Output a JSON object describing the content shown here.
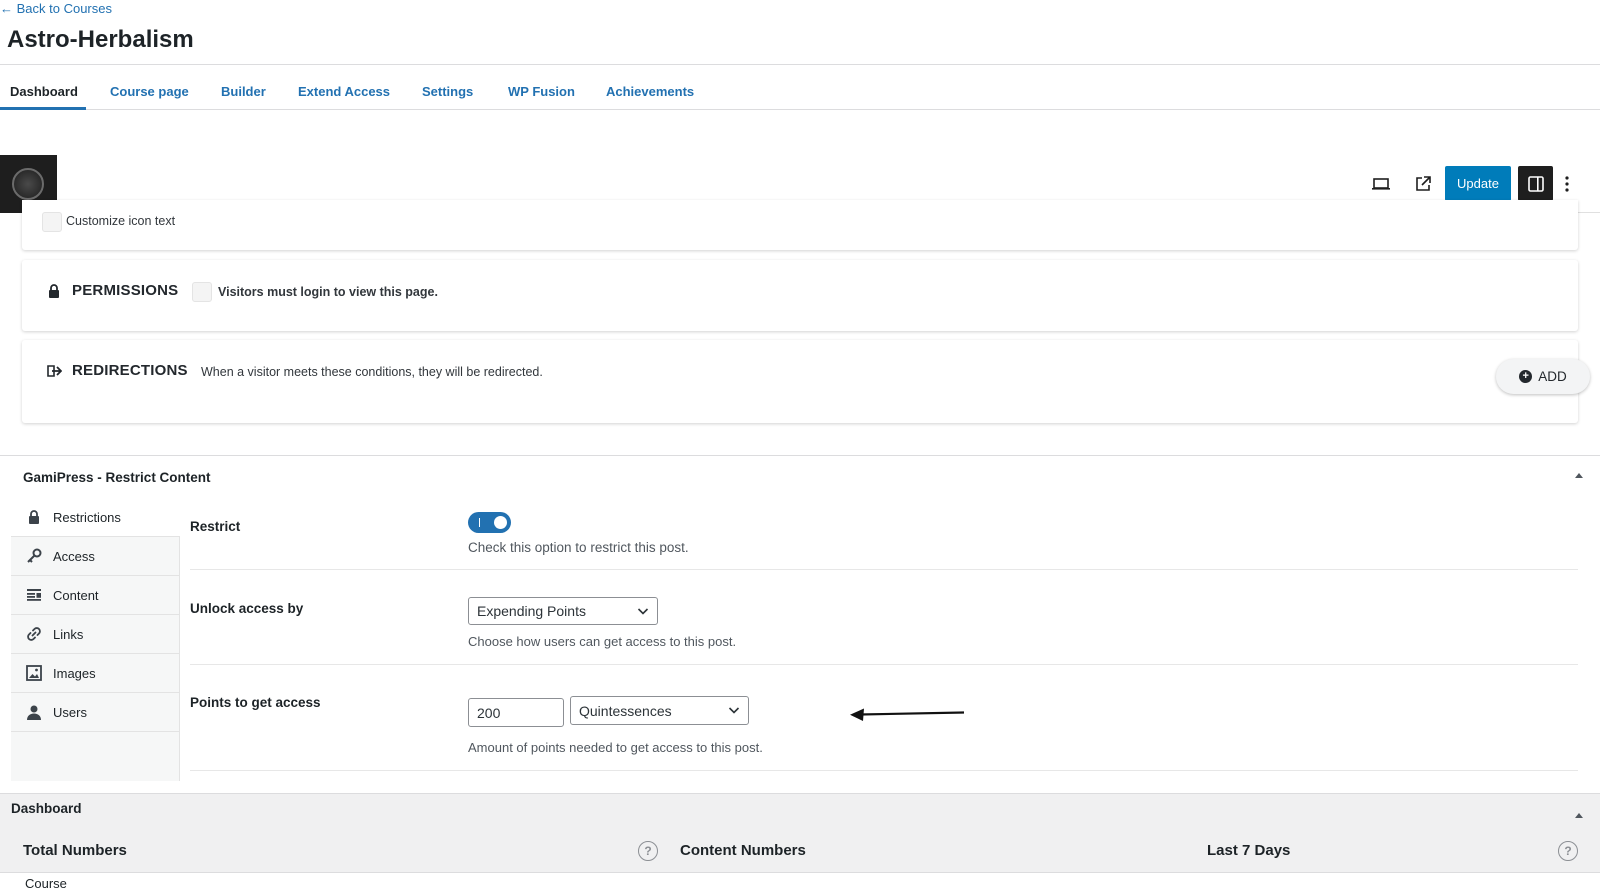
{
  "header": {
    "back_link": "← Back to Courses",
    "title": "Astro-Herbalism"
  },
  "tabs": [
    {
      "label": "Dashboard",
      "active": true
    },
    {
      "label": "Course page"
    },
    {
      "label": "Builder"
    },
    {
      "label": "Extend Access"
    },
    {
      "label": "Settings"
    },
    {
      "label": "WP Fusion"
    },
    {
      "label": "Achievements"
    }
  ],
  "toolbar": {
    "update_label": "Update",
    "icons": [
      "preview-desktop-icon",
      "external-link-icon",
      "sidebar-toggle-icon",
      "more-vertical-icon"
    ]
  },
  "panels": {
    "icon_text_checkbox_label": "Customize icon text",
    "permissions_title": "PERMISSIONS",
    "permissions_checkbox_label": "Visitors must login to view this page.",
    "redirections_title": "REDIRECTIONS",
    "redirections_desc": "When a visitor meets these conditions, they will be redirected.",
    "add_label": "ADD"
  },
  "gamipress": {
    "title": "GamiPress - Restrict Content",
    "nav": [
      {
        "label": "Restrictions",
        "icon": "lock-icon"
      },
      {
        "label": "Access",
        "icon": "key-icon"
      },
      {
        "label": "Content",
        "icon": "content-icon"
      },
      {
        "label": "Links",
        "icon": "link-icon"
      },
      {
        "label": "Images",
        "icon": "image-icon"
      },
      {
        "label": "Users",
        "icon": "user-icon"
      }
    ],
    "restrict_label": "Restrict",
    "restrict_enabled": true,
    "restrict_desc": "Check this option to restrict this post.",
    "unlock_label": "Unlock access by",
    "unlock_value": "Expending Points",
    "unlock_desc": "Choose how users can get access to this post.",
    "points_label": "Points to get access",
    "points_value": "200",
    "points_type": "Quintessences",
    "points_desc": "Amount of points needed to get access to this post."
  },
  "dashboard": {
    "title": "Dashboard",
    "total_numbers": "Total Numbers",
    "content_numbers": "Content Numbers",
    "last_7_days": "Last 7 Days",
    "course_label": "Course"
  },
  "colors": {
    "accent": "#2271b1",
    "update_button": "#007cba",
    "dark": "#1e1e1e"
  }
}
